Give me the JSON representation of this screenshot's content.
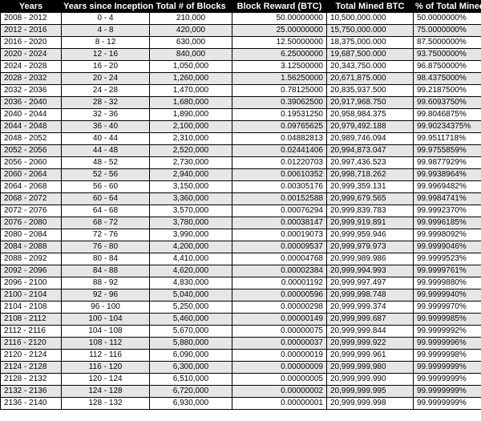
{
  "table": {
    "headers": [
      "Years",
      "Years since Inception",
      "Total # of Blocks",
      "Block Reward (BTC)",
      "Total Mined BTC",
      "% of Total Mined"
    ],
    "rows": [
      [
        "2008 - 2012",
        "0 - 4",
        "210,000",
        "50.00000000",
        "10,500,000.000",
        "50.0000000%"
      ],
      [
        "2012 - 2016",
        "4 - 8",
        "420,000",
        "25.00000000",
        "15,750,000.000",
        "75.0000000%"
      ],
      [
        "2016 - 2020",
        "8 - 12",
        "630,000",
        "12.50000000",
        "18,375,000.000",
        "87.5000000%"
      ],
      [
        "2020 - 2024",
        "12 - 16",
        "840,000",
        "6.25000000",
        "19,687,500.000",
        "93.7500000%"
      ],
      [
        "2024 - 2028",
        "16 - 20",
        "1,050,000",
        "3.12500000",
        "20,343,750.000",
        "96.8750000%"
      ],
      [
        "2028 - 2032",
        "20 - 24",
        "1,260,000",
        "1.56250000",
        "20,671,875.000",
        "98.4375000%"
      ],
      [
        "2032 - 2036",
        "24 - 28",
        "1,470,000",
        "0.78125000",
        "20,835,937.500",
        "99.2187500%"
      ],
      [
        "2036 - 2040",
        "28 - 32",
        "1,680,000",
        "0.39062500",
        "20,917,968.750",
        "99.6093750%"
      ],
      [
        "2040 - 2044",
        "32 - 36",
        "1,890,000",
        "0.19531250",
        "20,958,984.375",
        "99.8046875%"
      ],
      [
        "2044 - 2048",
        "36 - 40",
        "2,100,000",
        "0.09765625",
        "20,979,492.188",
        "99.9023437 5%"
      ],
      [
        "2048 - 2052",
        "40 - 44",
        "2,310,000",
        "0.04882813",
        "20,989,746.094",
        "99.9511718%"
      ],
      [
        "2052 - 2056",
        "44 - 48",
        "2,520,000",
        "0.02441406",
        "20,994,873.047",
        "99.9755859%"
      ],
      [
        "2056 - 2060",
        "48 - 52",
        "2,730,000",
        "0.01220703",
        "20,997,436.523",
        "99.9877929%"
      ],
      [
        "2060 - 2064",
        "52 - 56",
        "2,940,000",
        "0.00610352",
        "20,998,718.262",
        "99.9938964%"
      ],
      [
        "2064 - 2068",
        "56 - 60",
        "3,150,000",
        "0.00305176",
        "20,999,359.131",
        "99.9969482%"
      ],
      [
        "2068 - 2072",
        "60 - 64",
        "3,360,000",
        "0.00152588",
        "20,999,679.565",
        "99.9984741%"
      ],
      [
        "2072 - 2076",
        "64 - 68",
        "3,570,000",
        "0.00076294",
        "20,999,839.783",
        "99.9992370%"
      ],
      [
        "2076 - 2080",
        "68 - 72",
        "3,780,000",
        "0.00038147",
        "20,999,919.891",
        "99.9996185%"
      ],
      [
        "2080 - 2084",
        "72 - 76",
        "3,990,000",
        "0.00019073",
        "20,999,959.946",
        "99.9998092%"
      ],
      [
        "2084 - 2088",
        "76 - 80",
        "4,200,000",
        "0.00009537",
        "20,999,979.973",
        "99.9999046%"
      ],
      [
        "2088 - 2092",
        "80 - 84",
        "4,410,000",
        "0.00004768",
        "20,999,989.986",
        "99.9999523%"
      ],
      [
        "2092 - 2096",
        "84 - 88",
        "4,620,000",
        "0.00002384",
        "20,999,994.993",
        "99.9999761%"
      ],
      [
        "2096 - 2100",
        "88 - 92",
        "4,830,000",
        "0.00001192",
        "20,999,997.497",
        "99.9999880%"
      ],
      [
        "2100 - 2104",
        "92 - 96",
        "5,040,000",
        "0.00000596",
        "20,999,998.748",
        "99.9999940%"
      ],
      [
        "2104 - 2108",
        "96 - 100",
        "5,250,000",
        "0.00000298",
        "20,999,999.374",
        "99.9999970%"
      ],
      [
        "2108 - 2112",
        "100 - 104",
        "5,460,000",
        "0.00000149",
        "20,999,999.687",
        "99.9999985%"
      ],
      [
        "2112 - 2116",
        "104 - 108",
        "5,670,000",
        "0.00000075",
        "20,999,999.844",
        "99.9999992%"
      ],
      [
        "2116 - 2120",
        "108 - 112",
        "5,880,000",
        "0.00000037",
        "20,999,999.922",
        "99.9999996%"
      ],
      [
        "2120 - 2124",
        "112 - 116",
        "6,090,000",
        "0.00000019",
        "20,999,999.961",
        "99.9999998%"
      ],
      [
        "2124 - 2128",
        "116 - 120",
        "6,300,000",
        "0.00000009",
        "20,999,999.980",
        "99.9999999%"
      ],
      [
        "2128 - 2132",
        "120 - 124",
        "6,510,000",
        "0.00000005",
        "20,999,999.990",
        "99.9999999%"
      ],
      [
        "2132 - 2136",
        "124 - 128",
        "6,720,000",
        "0.00000002",
        "20,999,999.995",
        "99.9999999%"
      ],
      [
        "2136 - 2140",
        "128 - 132",
        "6,930,000",
        "0.00000001",
        "20,999,999.998",
        "99.9999999%"
      ]
    ]
  }
}
